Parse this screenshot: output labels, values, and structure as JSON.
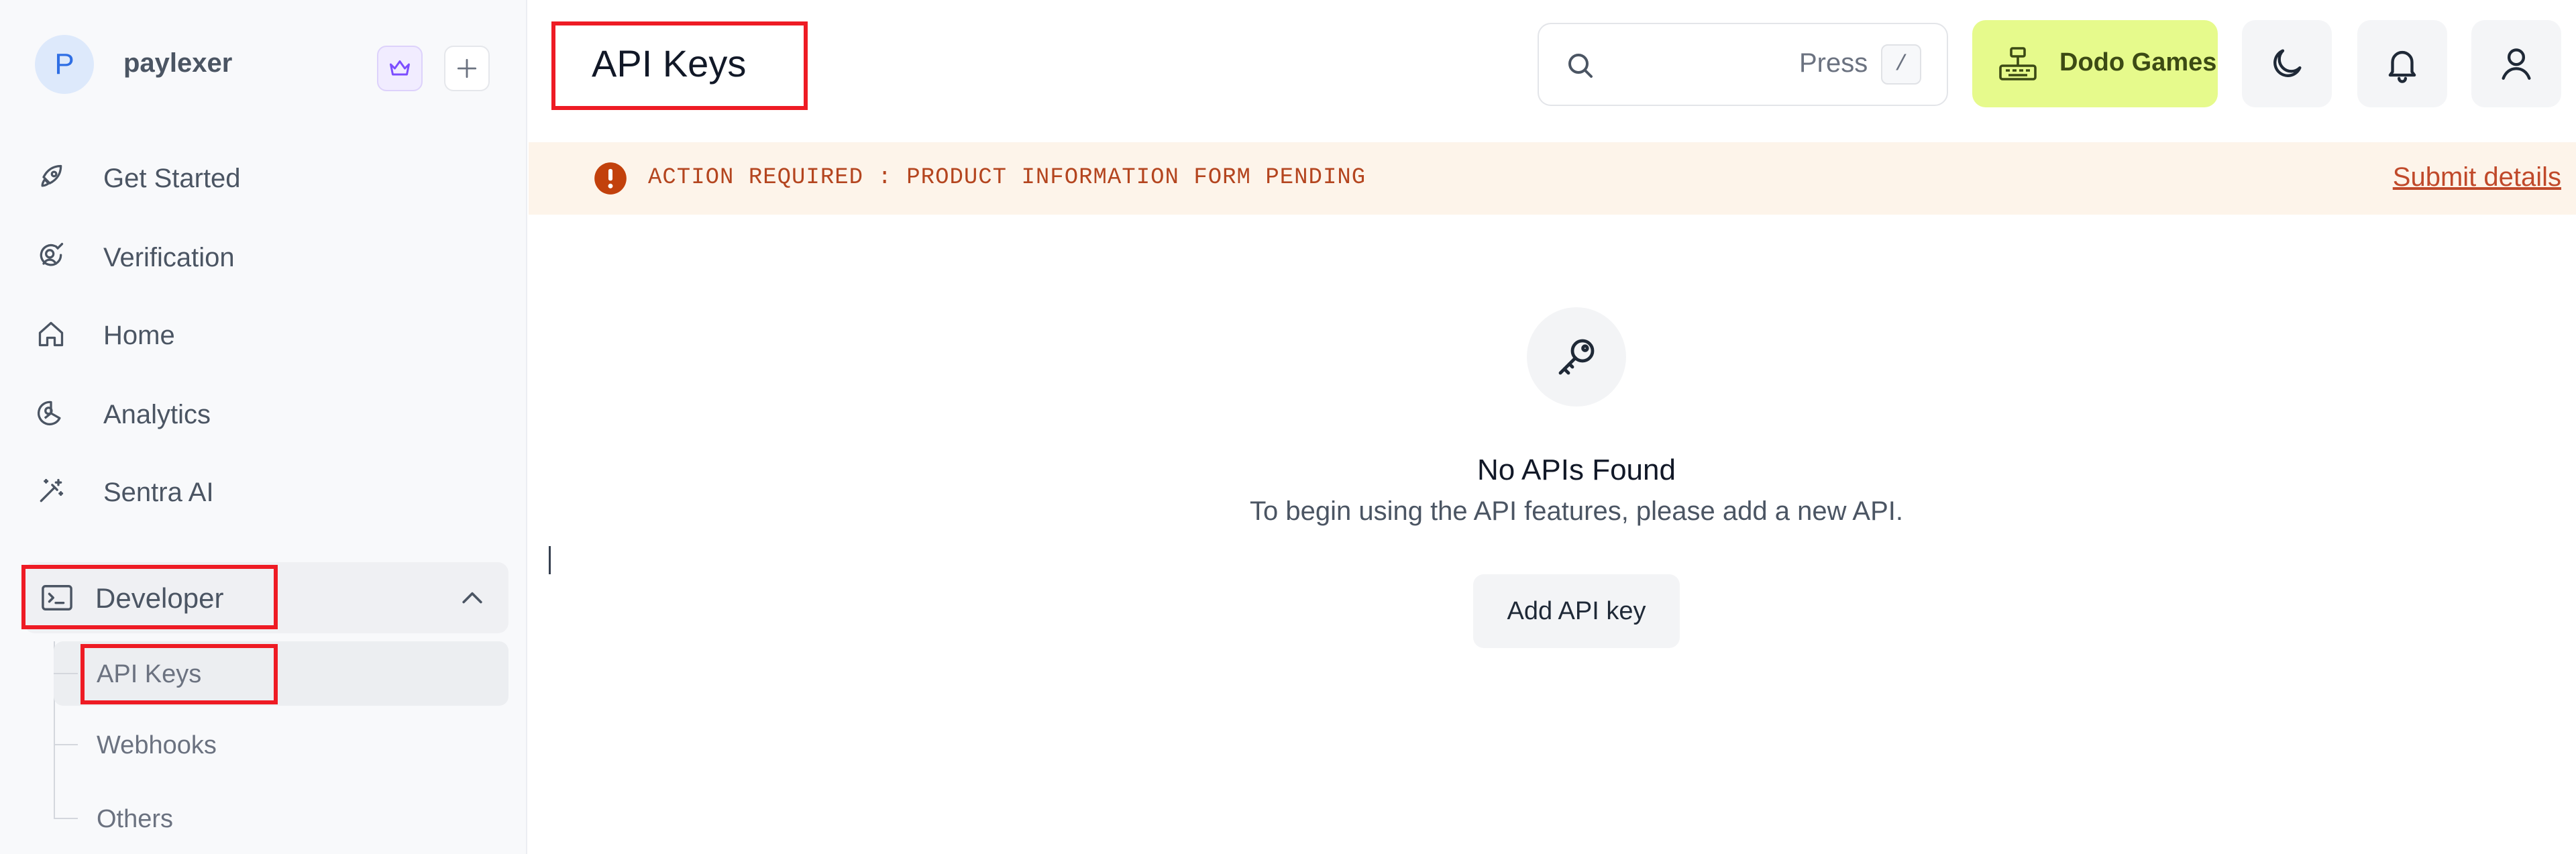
{
  "workspace": {
    "initial": "P",
    "name": "paylexer"
  },
  "sidebar": {
    "items": [
      {
        "label": "Get Started",
        "icon": "rocket-icon"
      },
      {
        "label": "Verification",
        "icon": "user-check-icon"
      },
      {
        "label": "Home",
        "icon": "home-icon"
      },
      {
        "label": "Analytics",
        "icon": "pie-chart-icon"
      },
      {
        "label": "Sentra AI",
        "icon": "magic-wand-icon"
      }
    ],
    "developer": {
      "label": "Developer",
      "expanded": true,
      "children": [
        {
          "label": "API Keys",
          "active": true
        },
        {
          "label": "Webhooks",
          "active": false
        },
        {
          "label": "Others",
          "active": false
        }
      ]
    }
  },
  "header": {
    "title": "API Keys",
    "search_hint": "Press",
    "search_shortcut": "/",
    "store_label": "Dodo Games"
  },
  "banner": {
    "text": "ACTION REQUIRED : PRODUCT INFORMATION FORM PENDING",
    "link": "Submit details"
  },
  "empty_state": {
    "title": "No APIs Found",
    "description": "To begin using the API features, please add a new API.",
    "button": "Add API key"
  },
  "colors": {
    "accent_blue": "#2f6fe4",
    "highlight_red": "#ee1b24",
    "banner_bg": "#fdf4ea",
    "banner_text": "#b4451f",
    "store_button": "#e6fa8c"
  }
}
